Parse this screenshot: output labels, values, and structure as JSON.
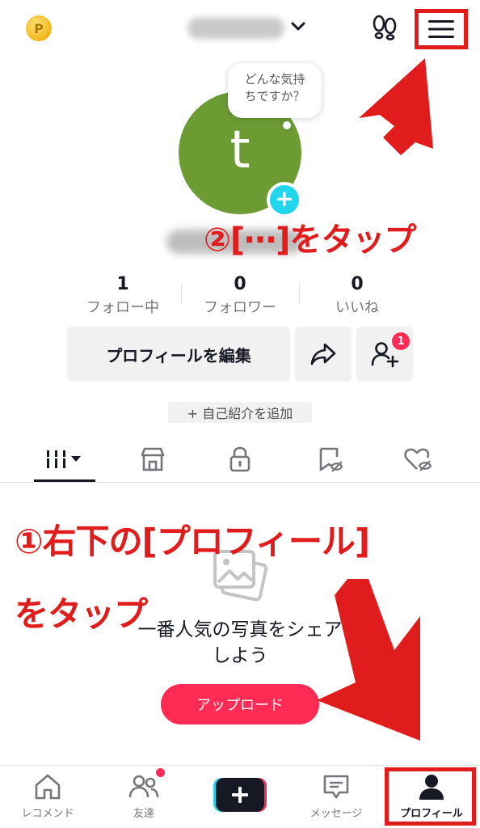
{
  "header": {
    "username": "",
    "menu_icon": "hamburger-menu-icon"
  },
  "profile": {
    "avatar_letter": "t",
    "bubble_line1": "どんな気持",
    "bubble_line2": "ちですか？",
    "display_name": ""
  },
  "stats": [
    {
      "value": "1",
      "label": "フォロー中"
    },
    {
      "value": "0",
      "label": "フォロワー"
    },
    {
      "value": "0",
      "label": "いいね"
    }
  ],
  "actions": {
    "edit_profile": "プロフィールを編集",
    "friend_requests_badge": "1",
    "add_bio": "+ 自己紹介を追加"
  },
  "tabs": [
    "videos-grid",
    "shop",
    "private",
    "favorites",
    "liked"
  ],
  "empty_state": {
    "line1": "一番人気の写真をシェア",
    "line2": "しよう",
    "upload_label": "アップロード"
  },
  "annotations": {
    "step2": "②[⋯]をタップ",
    "step1_line1": "①右下の[プロフィール]",
    "step1_line2": "をタップ",
    "color": "#e11c1c"
  },
  "bottom_nav": [
    {
      "label": "レコメンド",
      "icon": "home-icon"
    },
    {
      "label": "友達",
      "icon": "friends-icon"
    },
    {
      "label": "",
      "icon": "create-icon"
    },
    {
      "label": "メッセージ",
      "icon": "inbox-icon"
    },
    {
      "label": "プロフィール",
      "icon": "profile-icon"
    }
  ],
  "colors": {
    "accent": "#fe2c55",
    "cyan": "#20d5ec",
    "avatar": "#6c9b34"
  }
}
